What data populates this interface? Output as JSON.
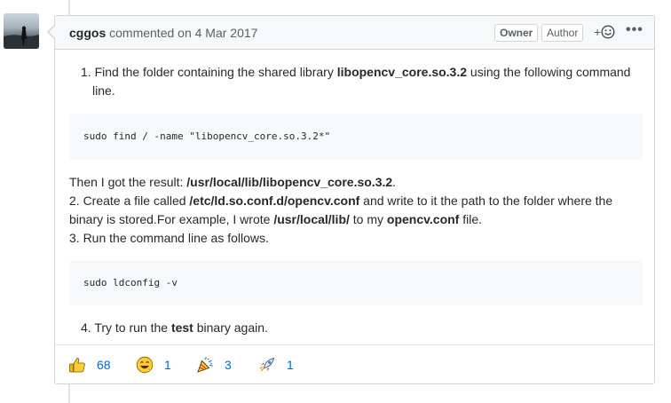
{
  "comment": {
    "author": "cggos",
    "action": "commented on",
    "date": "4 Mar 2017",
    "labels": {
      "owner": "Owner",
      "author": "Author"
    },
    "header_actions": {
      "add_reaction": "+",
      "more": "•••"
    },
    "body": {
      "step1_prefix": "1. Find the folder containing the shared library ",
      "step1_lib": "libopencv_core.so.3.2",
      "step1_suffix": " using the following command",
      "step1_line2": "line.",
      "code1": "sudo find / -name \"libopencv_core.so.3.2*\"",
      "result_prefix": "Then I got the result: ",
      "result_path": "/usr/local/lib/libopencv_core.so.3.2",
      "result_suffix": ".",
      "step2_prefix": "2. Create a file called ",
      "step2_file": "/etc/ld.so.conf.d/opencv.conf",
      "step2_suffix": " and write to it the path to the folder where the",
      "step2_line2_prefix": "binary is stored.For example, I wrote ",
      "step2_path": "/usr/local/lib/",
      "step2_mid": " to my ",
      "step2_conf": "opencv.conf",
      "step2_end": " file.",
      "step3": "3. Run the command line as follows.",
      "code2": "sudo ldconfig -v",
      "step4_prefix": "4. Try to run the ",
      "step4_bin": "test",
      "step4_suffix": " binary again."
    },
    "reactions": [
      {
        "icon": "thumbs-up-icon",
        "count": "68"
      },
      {
        "icon": "smile-icon",
        "count": "1"
      },
      {
        "icon": "tada-icon",
        "count": "3"
      },
      {
        "icon": "rocket-icon",
        "count": "1"
      }
    ]
  }
}
